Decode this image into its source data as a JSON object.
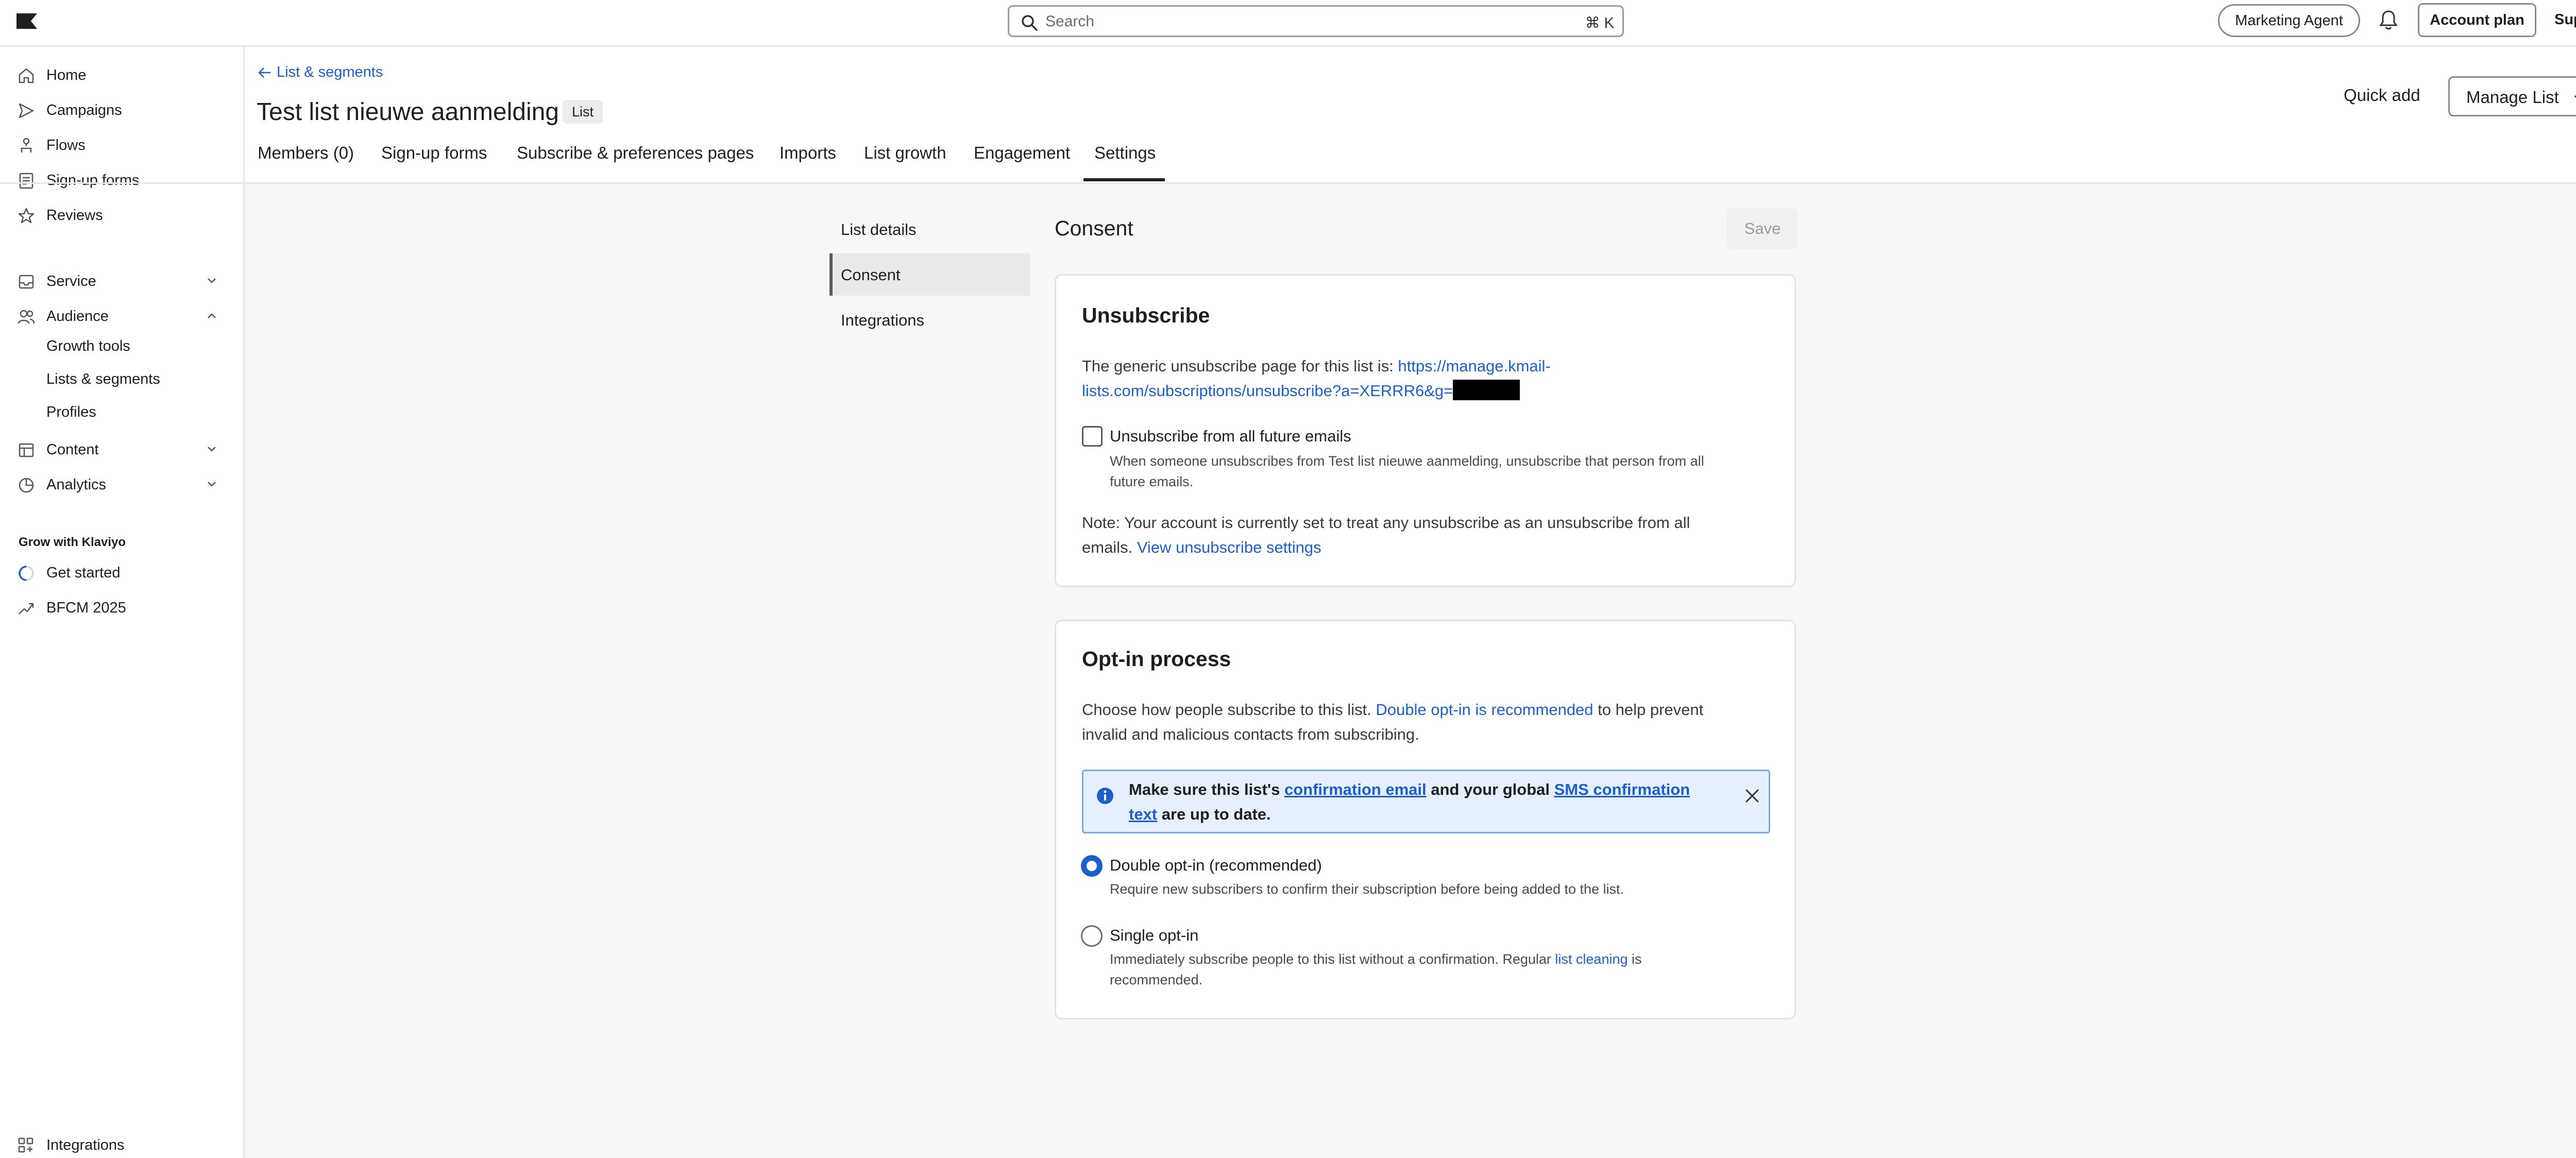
{
  "search": {
    "placeholder": "Search",
    "shortcut": "⌘ K"
  },
  "header": {
    "marketing_agent": "Marketing Agent",
    "account_plan": "Account plan",
    "support": "Support"
  },
  "sidebar": {
    "items": [
      {
        "label": "Home",
        "icon": "home-icon"
      },
      {
        "label": "Campaigns",
        "icon": "send-icon"
      },
      {
        "label": "Flows",
        "icon": "flow-icon"
      },
      {
        "label": "Sign-up forms",
        "icon": "form-icon"
      },
      {
        "label": "Reviews",
        "icon": "star-icon"
      },
      {
        "label": "Service",
        "icon": "inbox-icon"
      },
      {
        "label": "Audience",
        "icon": "people-icon"
      },
      {
        "label": "Content",
        "icon": "content-icon"
      },
      {
        "label": "Analytics",
        "icon": "chart-icon"
      }
    ],
    "audience_sub": [
      "Growth tools",
      "Lists & segments",
      "Profiles"
    ],
    "grow_title": "Grow with Klaviyo",
    "get_started": "Get started",
    "bfcm": "BFCM 2025",
    "integrations": "Integrations"
  },
  "page": {
    "back_link": "List & segments",
    "title": "Test list nieuwe aanmelding",
    "badge": "List",
    "quick_add": "Quick add",
    "manage_list": "Manage List",
    "tabs": [
      "Members (0)",
      "Sign-up forms",
      "Subscribe & preferences pages",
      "Imports",
      "List growth",
      "Engagement",
      "Settings"
    ]
  },
  "settings_nav": [
    "List details",
    "Consent",
    "Integrations"
  ],
  "consent": {
    "title": "Consent",
    "save": "Save",
    "unsubscribe": {
      "title": "Unsubscribe",
      "generic_text": "The generic unsubscribe page for this list is: ",
      "url_line1": "https://manage.kmail-",
      "url_line2": "lists.com/subscriptions/unsubscribe?a=XERRR6&g=",
      "checkbox_label": "Unsubscribe from all future emails",
      "checkbox_desc_line1": "When someone unsubscribes from Test list nieuwe aanmelding, unsubscribe that person from all",
      "checkbox_desc_line2": "future emails.",
      "note_line1": "Note: Your account is currently set to treat any unsubscribe as an unsubscribe from all",
      "note_line2": "emails. ",
      "note_link": "View unsubscribe settings"
    },
    "optin": {
      "title": "Opt-in process",
      "intro_part1": "Choose how people subscribe to this list. ",
      "intro_link": "Double opt-in is recommended",
      "intro_part2": " to help prevent",
      "intro_line2": "invalid and malicious contacts from subscribing.",
      "info_part1": "Make sure this list's ",
      "info_link1": "confirmation email",
      "info_part2": " and your global ",
      "info_link2": "SMS confirmation text",
      "info_part3": " are up to date.",
      "double_label": "Double opt-in (recommended)",
      "double_desc": "Require new subscribers to confirm their subscription before being added to the list.",
      "single_label": "Single opt-in",
      "single_desc_part1": "Immediately subscribe people to this list without a confirmation. Regular ",
      "single_desc_link": "list cleaning",
      "single_desc_part2": " is",
      "single_desc_line2": "recommended."
    }
  },
  "colors": {
    "link": "#1d5fc9",
    "info_bg": "#e6f0fc",
    "info_border": "#7aa8e6"
  }
}
